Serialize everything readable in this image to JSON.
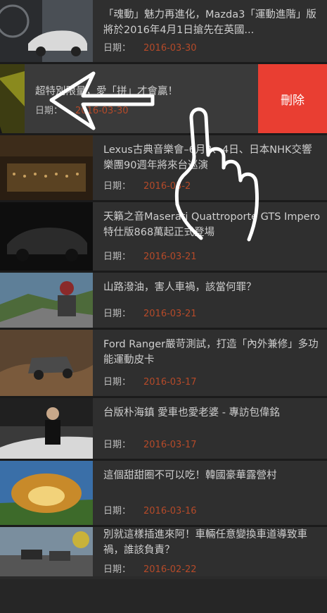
{
  "articles": [
    {
      "title": "「魂動」魅力再進化，Mazda3「運動進階」版將於2016年4月1日搶先在英國...",
      "date_label": "日期：",
      "date": "2016-03-30"
    },
    {
      "title": "超特別限量，愛「拼」才會贏！",
      "date_label": "日期：",
      "date": "2016-03-30"
    },
    {
      "title": "Lexus古典音樂會–6月3、4日、日本NHK交響樂團90週年將來台巡演",
      "date_label": "日期：",
      "date": "2016-03-2"
    },
    {
      "title": "天籟之音Maserati Quattroporte GTS Impero特仕版868萬起正式登場",
      "date_label": "日期：",
      "date": "2016-03-21"
    },
    {
      "title": "山路潑油，害人車禍，該當何罪？",
      "date_label": "日期：",
      "date": "2016-03-21"
    },
    {
      "title": "Ford Ranger嚴苛測試，打造「內外兼修」多功能運動皮卡",
      "date_label": "日期：",
      "date": "2016-03-17"
    },
    {
      "title": "台版朴海鎮 愛車也愛老婆 - 專訪包偉銘",
      "date_label": "日期：",
      "date": "2016-03-17"
    },
    {
      "title": "這個甜甜圈不可以吃！韓國豪華露營村",
      "date_label": "日期：",
      "date": "2016-03-16"
    },
    {
      "title": "別就這樣插進來阿！車輛任意變換車道導致車禍，誰該負責？",
      "date_label": "日期：",
      "date": "2016-02-22"
    }
  ],
  "swipe_action": {
    "label": "刪除",
    "color": "#e93e32"
  },
  "colors": {
    "date": "#b54a29",
    "background": "#2f2f2f"
  },
  "gesture": {
    "icons": [
      "left-arrow-icon",
      "swipe-hand-icon"
    ]
  }
}
